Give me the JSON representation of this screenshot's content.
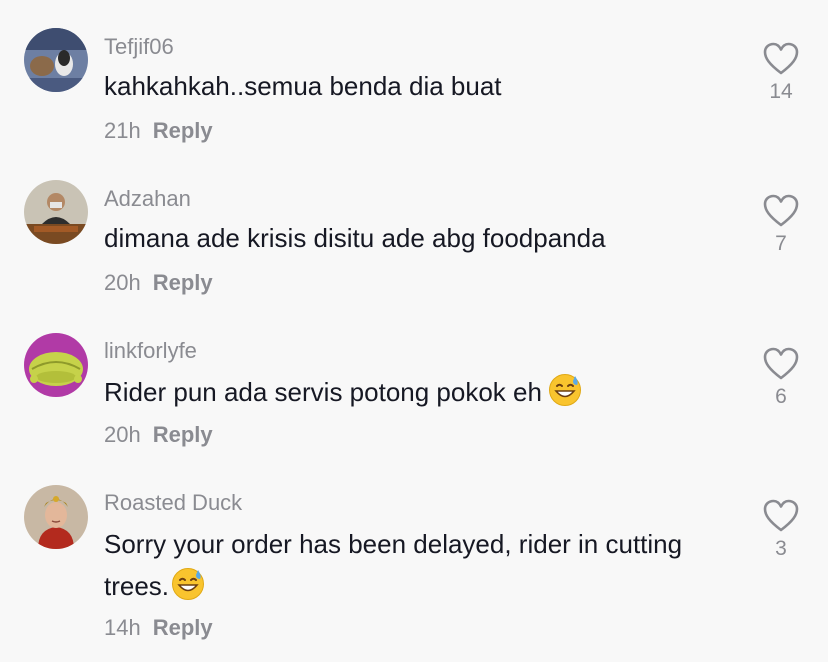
{
  "comments": [
    {
      "username": "Tefjif06",
      "text": "kahkahkah..semua benda dia buat",
      "time": "21h",
      "reply_label": "Reply",
      "likes": "14",
      "has_emoji": false
    },
    {
      "username": "Adzahan",
      "text": "dimana ade krisis disitu ade abg foodpanda",
      "time": "20h",
      "reply_label": "Reply",
      "likes": "7",
      "has_emoji": false
    },
    {
      "username": "linkforlyfe",
      "text": "Rider pun ada servis potong pokok eh",
      "time": "20h",
      "reply_label": "Reply",
      "likes": "6",
      "has_emoji": true,
      "emoji_icon": "grinning-sweat-emoji"
    },
    {
      "username": "Roasted Duck",
      "text": "Sorry your order has been delayed, rider in cutting trees.",
      "time": "14h",
      "reply_label": "Reply",
      "likes": "3",
      "has_emoji": true,
      "emoji_icon": "grinning-sweat-emoji"
    }
  ],
  "icons": {
    "like": "heart-outline-icon"
  },
  "colors": {
    "background": "#f8f8f8",
    "primary_text": "#161823",
    "secondary_text": "#8a8b91"
  }
}
